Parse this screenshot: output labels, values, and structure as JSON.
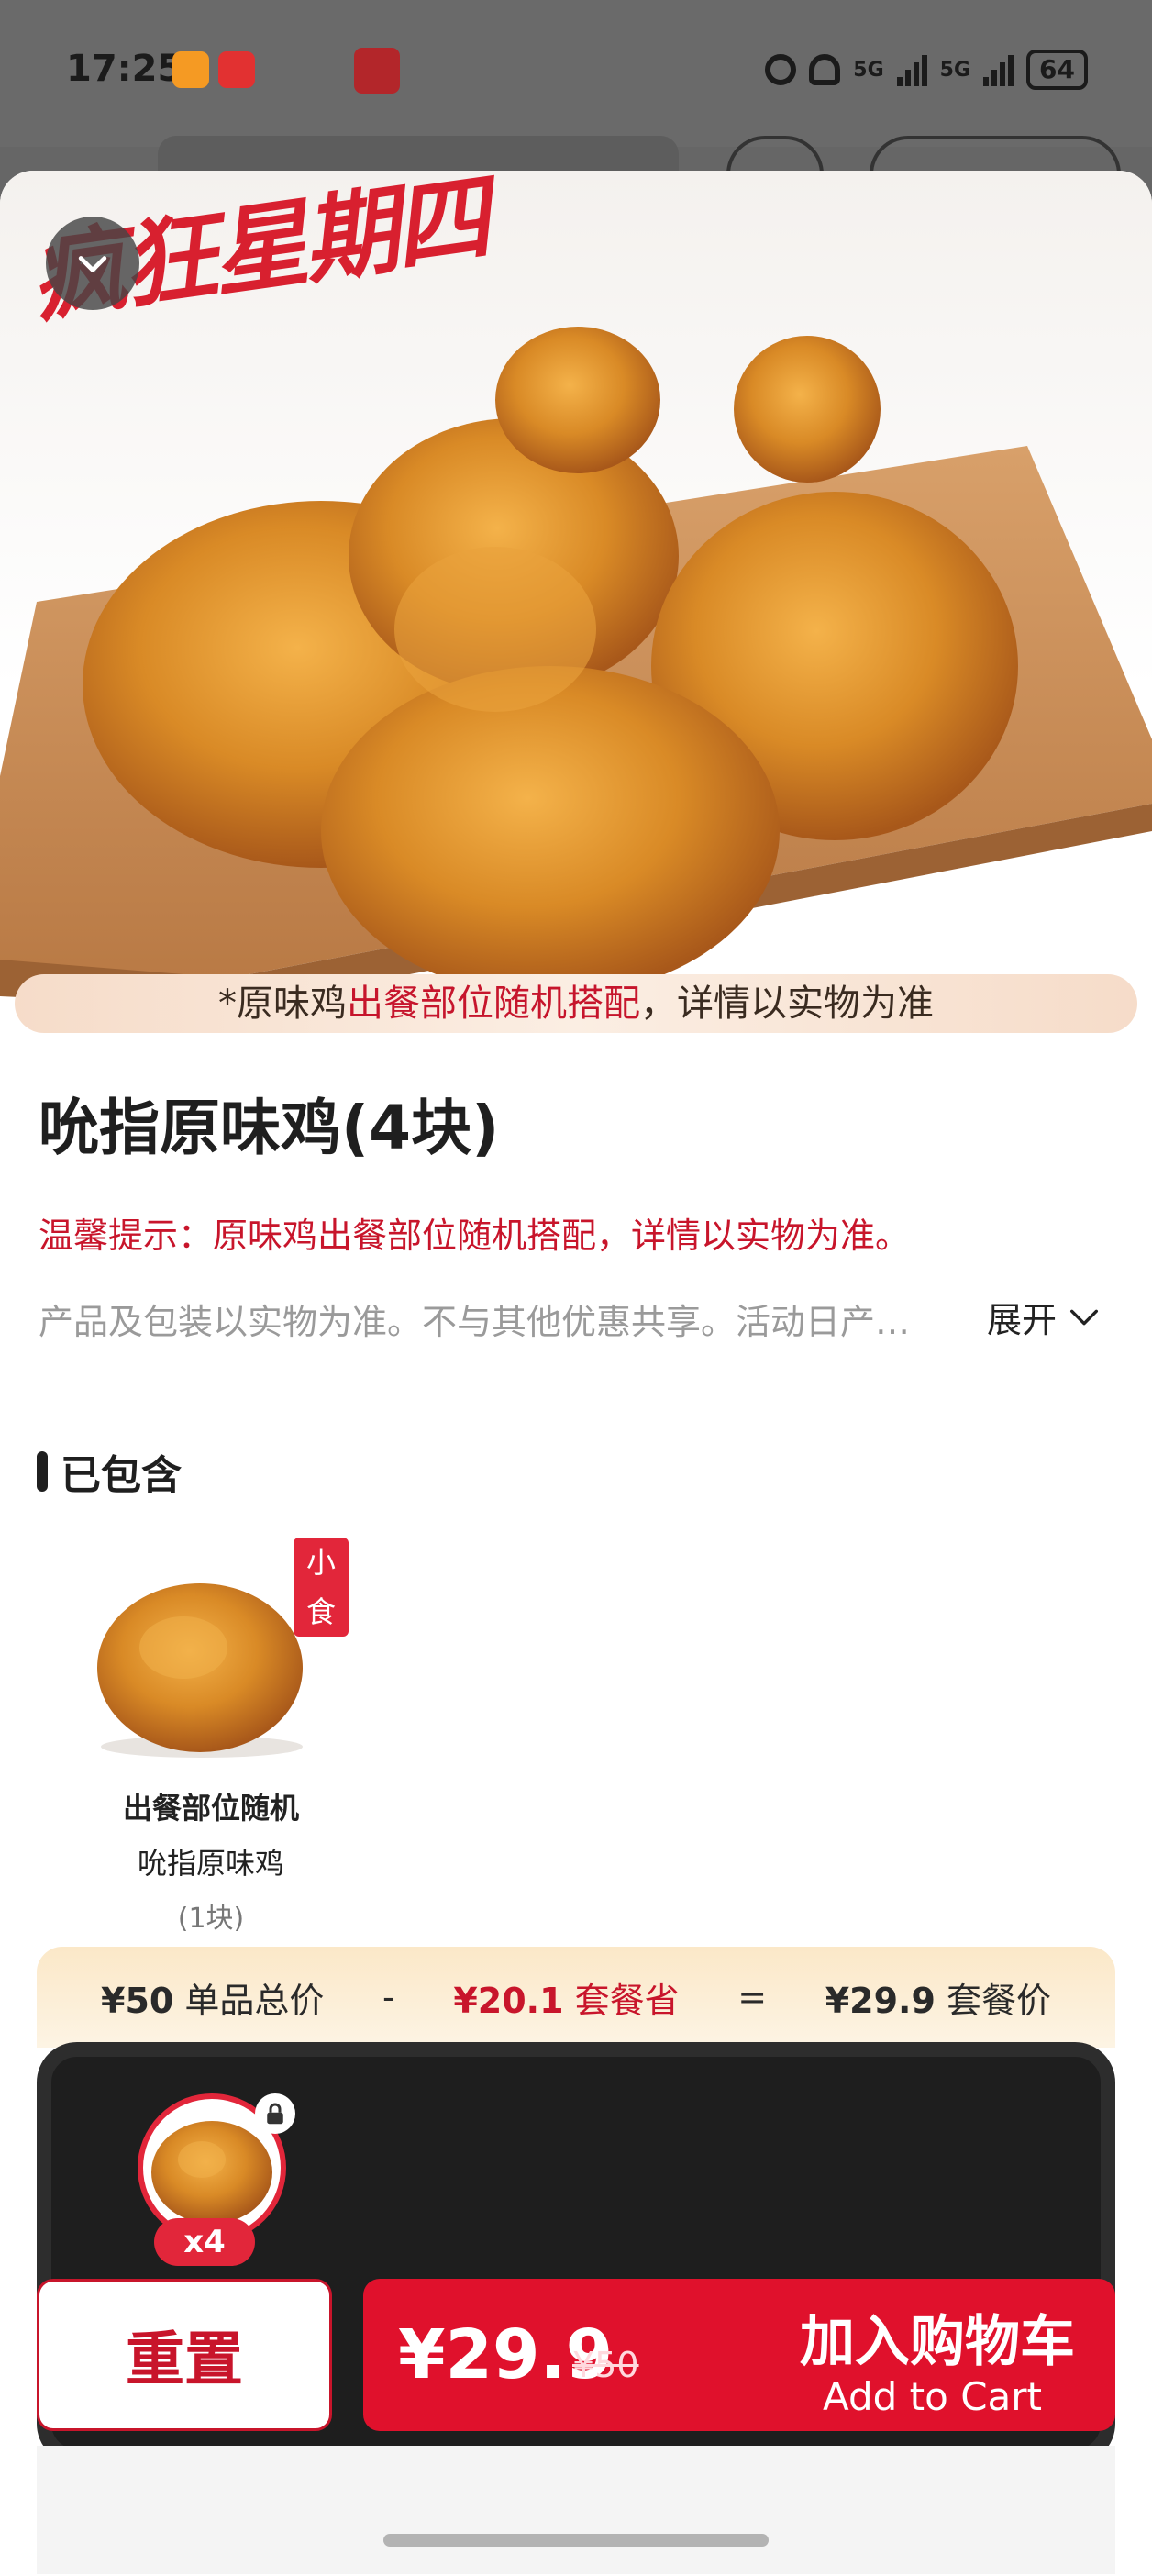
{
  "status_bar": {
    "time": "17:25",
    "battery": "64",
    "network": "5G"
  },
  "hero": {
    "promo_title": "疯狂星期四",
    "caption_prefix": "*原味鸡",
    "caption_highlight": "出餐部位随机搭配",
    "caption_suffix": "，详情以实物为准"
  },
  "product": {
    "title": "吮指原味鸡(4块)",
    "tip": "温馨提示：原味鸡出餐部位随机搭配，详情以实物为准。",
    "description": "产品及包装以实物为准。不与其他优惠共享。活动日产…",
    "expand_label": "展开"
  },
  "included": {
    "section_label": "已包含",
    "items": [
      {
        "tag": "小食",
        "line1": "出餐部位随机",
        "line2": "吮指原味鸡",
        "line3": "(1块)",
        "qty": "4份"
      }
    ]
  },
  "price_summary": {
    "single_total": "¥50",
    "single_total_label": "单品总价",
    "minus": "-",
    "save_amount": "¥20.1",
    "save_label": "套餐省",
    "equals": "=",
    "set_price": "¥29.9",
    "set_price_label": "套餐价"
  },
  "selection": {
    "qty_badge": "x4"
  },
  "actions": {
    "reset_label": "重置",
    "price": "¥29.9",
    "original_price": "¥50",
    "add_cart_label": "加入购物车",
    "add_cart_sub": "Add to Cart"
  },
  "colors": {
    "brand_red": "#e0112c",
    "accent_red": "#c8152b"
  },
  "icons": [
    "chevron-down-icon",
    "lock-icon",
    "alarm-icon",
    "headphones-icon",
    "signal-icon",
    "battery-icon"
  ]
}
